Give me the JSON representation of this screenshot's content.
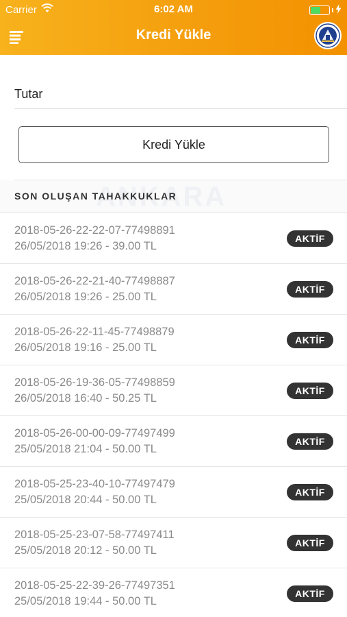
{
  "status_bar": {
    "carrier": "Carrier",
    "time": "6:02 AM"
  },
  "nav": {
    "title": "Kredi Yükle",
    "menu_icon": "hamburger-menu-icon",
    "logo_icon": "ankara-municipality-logo"
  },
  "form": {
    "amount_placeholder": "Tutar",
    "amount_value": "",
    "submit_label": "Kredi Yükle"
  },
  "section": {
    "title": "SON OLUŞAN TAHAKKUKLAR",
    "watermark": "ANKARA"
  },
  "items": [
    {
      "id": "2018-05-26-22-22-07-77498891",
      "detail": "26/05/2018 19:26 - 39.00 TL",
      "status": "AKTİF"
    },
    {
      "id": "2018-05-26-22-21-40-77498887",
      "detail": "26/05/2018 19:26 - 25.00 TL",
      "status": "AKTİF"
    },
    {
      "id": "2018-05-26-22-11-45-77498879",
      "detail": "26/05/2018 19:16 - 25.00 TL",
      "status": "AKTİF"
    },
    {
      "id": "2018-05-26-19-36-05-77498859",
      "detail": "26/05/2018 16:40 - 50.25 TL",
      "status": "AKTİF"
    },
    {
      "id": "2018-05-26-00-00-09-77497499",
      "detail": "25/05/2018 21:04 - 50.00 TL",
      "status": "AKTİF"
    },
    {
      "id": "2018-05-25-23-40-10-77497479",
      "detail": "25/05/2018 20:44 - 50.00 TL",
      "status": "AKTİF"
    },
    {
      "id": "2018-05-25-23-07-58-77497411",
      "detail": "25/05/2018 20:12 - 50.00 TL",
      "status": "AKTİF"
    },
    {
      "id": "2018-05-25-22-39-26-77497351",
      "detail": "25/05/2018 19:44 - 50.00 TL",
      "status": "AKTİF"
    }
  ],
  "colors": {
    "header_start": "#f7b21c",
    "header_end": "#f39100",
    "badge_bg": "#333333",
    "battery_green": "#4cd964"
  }
}
